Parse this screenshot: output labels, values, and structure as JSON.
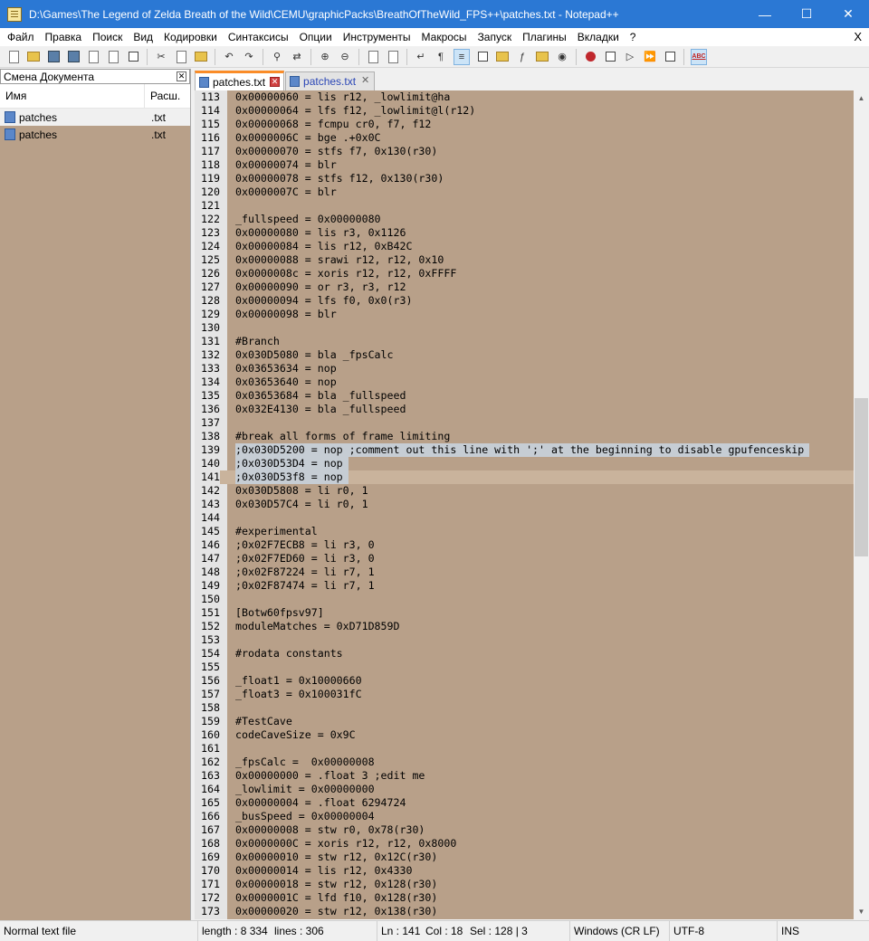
{
  "window": {
    "title": "D:\\Games\\The Legend of Zelda Breath of the Wild\\CEMU\\graphicPacks\\BreathOfTheWild_FPS++\\patches.txt - Notepad++",
    "minimize": "—",
    "maximize": "☐",
    "close": "✕"
  },
  "menu": {
    "items": [
      "Файл",
      "Правка",
      "Поиск",
      "Вид",
      "Кодировки",
      "Синтаксисы",
      "Опции",
      "Инструменты",
      "Макросы",
      "Запуск",
      "Плагины",
      "Вкладки",
      "?"
    ],
    "close": "X"
  },
  "toolbar": {
    "icons": [
      "new-file-icon",
      "open-file-icon",
      "save-icon",
      "save-all-icon",
      "close-icon",
      "close-all-icon",
      "print-icon",
      "cut-icon",
      "copy-icon",
      "paste-icon",
      "undo-icon",
      "redo-icon",
      "find-icon",
      "replace-icon",
      "zoom-in-icon",
      "zoom-out-icon",
      "sync-v-icon",
      "sync-h-icon",
      "word-wrap-icon",
      "all-chars-icon",
      "indent-guide-icon",
      "udl-icon",
      "doc-map-icon",
      "function-list-icon",
      "folder-workspace-icon",
      "monitor-icon",
      "record-macro-icon",
      "stop-macro-icon",
      "play-macro-icon",
      "run-macro-multiple-icon",
      "save-macro-icon",
      "spell-check-icon"
    ],
    "spell_label": "ABC"
  },
  "panel": {
    "title": "Смена Документа",
    "close": "✕",
    "col_name": "Имя",
    "col_ext": "Расш.",
    "docs": [
      {
        "name": "patches",
        "ext": ".txt"
      },
      {
        "name": "patches",
        "ext": ".txt"
      }
    ]
  },
  "tabs": [
    {
      "label": "patches.txt",
      "active": true
    },
    {
      "label": "patches.txt",
      "active": false
    }
  ],
  "editor": {
    "current_line": 141,
    "lines": [
      {
        "n": "113",
        "t": "0x00000060 = lis r12, _lowlimit@ha"
      },
      {
        "n": "114",
        "t": "0x00000064 = lfs f12, _lowlimit@l(r12)"
      },
      {
        "n": "115",
        "t": "0x00000068 = fcmpu cr0, f7, f12"
      },
      {
        "n": "116",
        "t": "0x0000006C = bge .+0x0C"
      },
      {
        "n": "117",
        "t": "0x00000070 = stfs f7, 0x130(r30)"
      },
      {
        "n": "118",
        "t": "0x00000074 = blr"
      },
      {
        "n": "119",
        "t": "0x00000078 = stfs f12, 0x130(r30)"
      },
      {
        "n": "120",
        "t": "0x0000007C = blr"
      },
      {
        "n": "121",
        "t": ""
      },
      {
        "n": "122",
        "t": "_fullspeed = 0x00000080"
      },
      {
        "n": "123",
        "t": "0x00000080 = lis r3, 0x1126"
      },
      {
        "n": "124",
        "t": "0x00000084 = lis r12, 0xB42C"
      },
      {
        "n": "125",
        "t": "0x00000088 = srawi r12, r12, 0x10"
      },
      {
        "n": "126",
        "t": "0x0000008c = xoris r12, r12, 0xFFFF"
      },
      {
        "n": "127",
        "t": "0x00000090 = or r3, r3, r12"
      },
      {
        "n": "128",
        "t": "0x00000094 = lfs f0, 0x0(r3)"
      },
      {
        "n": "129",
        "t": "0x00000098 = blr"
      },
      {
        "n": "130",
        "t": ""
      },
      {
        "n": "131",
        "t": "#Branch"
      },
      {
        "n": "132",
        "t": "0x030D5080 = bla _fpsCalc"
      },
      {
        "n": "133",
        "t": "0x03653634 = nop"
      },
      {
        "n": "134",
        "t": "0x03653640 = nop"
      },
      {
        "n": "135",
        "t": "0x03653684 = bla _fullspeed"
      },
      {
        "n": "136",
        "t": "0x032E4130 = bla _fullspeed"
      },
      {
        "n": "137",
        "t": ""
      },
      {
        "n": "138",
        "t": "#break all forms of frame limiting"
      },
      {
        "n": "139",
        "t": ";0x030D5200 = nop ;comment out this line with ';' at the beginning to disable gpufenceskip"
      },
      {
        "n": "140",
        "t": ";0x030D53D4 = nop"
      },
      {
        "n": "141",
        "t": ";0x030D53f8 = nop"
      },
      {
        "n": "142",
        "t": "0x030D5808 = li r0, 1"
      },
      {
        "n": "143",
        "t": "0x030D57C4 = li r0, 1"
      },
      {
        "n": "144",
        "t": ""
      },
      {
        "n": "145",
        "t": "#experimental"
      },
      {
        "n": "146",
        "t": ";0x02F7ECB8 = li r3, 0"
      },
      {
        "n": "147",
        "t": ";0x02F7ED60 = li r3, 0"
      },
      {
        "n": "148",
        "t": ";0x02F87224 = li r7, 1"
      },
      {
        "n": "149",
        "t": ";0x02F87474 = li r7, 1"
      },
      {
        "n": "150",
        "t": ""
      },
      {
        "n": "151",
        "t": "[Botw60fpsv97]"
      },
      {
        "n": "152",
        "t": "moduleMatches = 0xD71D859D"
      },
      {
        "n": "153",
        "t": ""
      },
      {
        "n": "154",
        "t": "#rodata constants"
      },
      {
        "n": "155",
        "t": ""
      },
      {
        "n": "156",
        "t": "_float1 = 0x10000660"
      },
      {
        "n": "157",
        "t": "_float3 = 0x100031fC"
      },
      {
        "n": "158",
        "t": ""
      },
      {
        "n": "159",
        "t": "#TestCave"
      },
      {
        "n": "160",
        "t": "codeCaveSize = 0x9C"
      },
      {
        "n": "161",
        "t": ""
      },
      {
        "n": "162",
        "t": "_fpsCalc =  0x00000008"
      },
      {
        "n": "163",
        "t": "0x00000000 = .float 3 ;edit me"
      },
      {
        "n": "164",
        "t": "_lowlimit = 0x00000000"
      },
      {
        "n": "165",
        "t": "0x00000004 = .float 6294724"
      },
      {
        "n": "166",
        "t": "_busSpeed = 0x00000004"
      },
      {
        "n": "167",
        "t": "0x00000008 = stw r0, 0x78(r30)"
      },
      {
        "n": "168",
        "t": "0x0000000C = xoris r12, r12, 0x8000"
      },
      {
        "n": "169",
        "t": "0x00000010 = stw r12, 0x12C(r30)"
      },
      {
        "n": "170",
        "t": "0x00000014 = lis r12, 0x4330"
      },
      {
        "n": "171",
        "t": "0x00000018 = stw r12, 0x128(r30)"
      },
      {
        "n": "172",
        "t": "0x0000001C = lfd f10, 0x128(r30)"
      },
      {
        "n": "173",
        "t": "0x00000020 = stw r12, 0x138(r30)"
      }
    ],
    "selected_lines": [
      "139",
      "140",
      "141"
    ]
  },
  "scrollbar": {
    "up": "▲",
    "down": "▼"
  },
  "status": {
    "filetype": "Normal text file",
    "length": "length : 8 334",
    "lines": "lines : 306",
    "ln": "Ln : 141",
    "col": "Col : 18",
    "sel": "Sel : 128 | 3",
    "eol": "Windows (CR LF)",
    "encoding": "UTF-8",
    "mode": "INS"
  },
  "colors": {
    "editor_bg": "#b8a089",
    "current_line_bg": "#c9b39c",
    "selection_bg": "#c6cdd4",
    "titlebar_bg": "#2b78d4",
    "active_tab_accent": "#fa8c28"
  }
}
